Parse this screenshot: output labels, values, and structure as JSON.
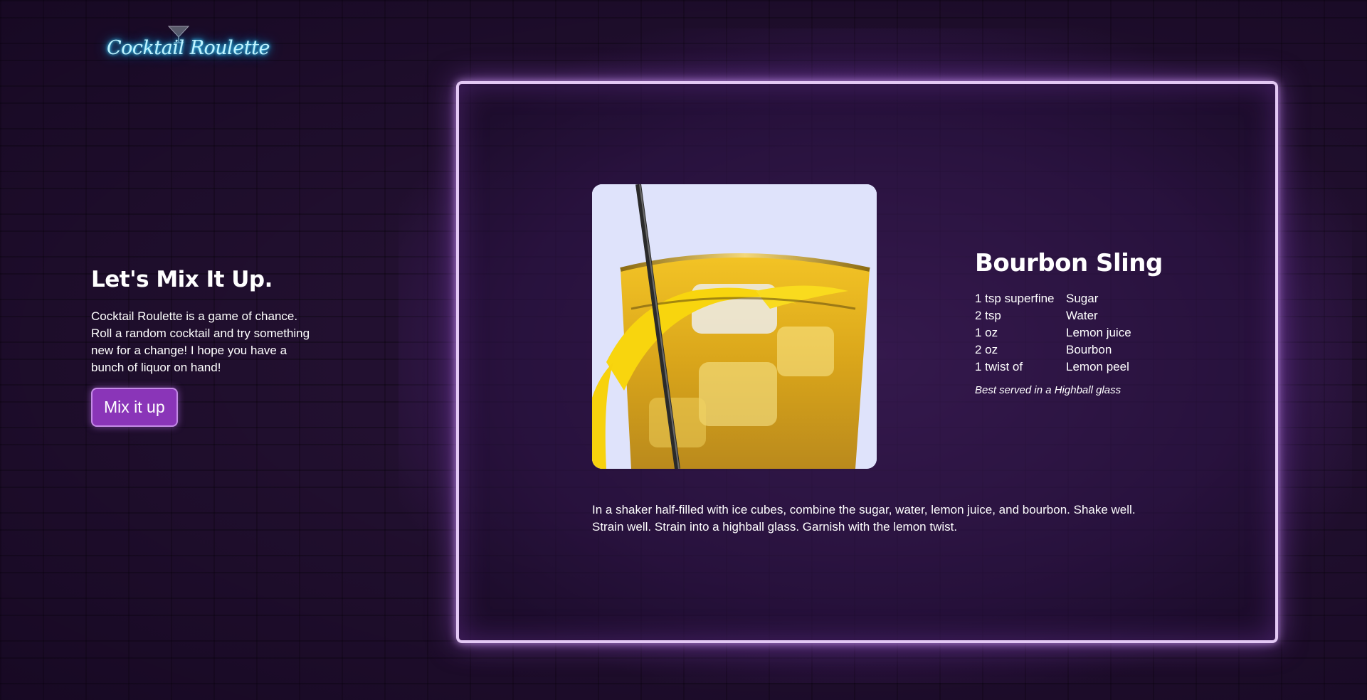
{
  "logo": {
    "text": "Cocktail Roulette"
  },
  "intro": {
    "heading": "Let's Mix It Up.",
    "description": "Cocktail Roulette is a game of chance. Roll a random cocktail and try something new for a change! I hope you have a bunch of liquor on hand!",
    "button_label": "Mix it up"
  },
  "drink": {
    "name": "Bourbon Sling",
    "ingredients": [
      {
        "measure": "1 tsp superfine",
        "item": "Sugar"
      },
      {
        "measure": "2 tsp",
        "item": "Water"
      },
      {
        "measure": "1 oz",
        "item": "Lemon juice"
      },
      {
        "measure": "2 oz",
        "item": "Bourbon"
      },
      {
        "measure": "1 twist of",
        "item": "Lemon peel"
      }
    ],
    "served": "Best served in a Highball glass",
    "instructions": "In a shaker half-filled with ice cubes, combine the sugar, water, lemon juice, and bourbon. Shake well. Strain well. Strain into a highball glass. Garnish with the lemon twist."
  },
  "colors": {
    "background": "#221030",
    "neon_logo": "#3fd6ff",
    "frame_border": "#e3c8f4",
    "button": "#8a35b8"
  }
}
